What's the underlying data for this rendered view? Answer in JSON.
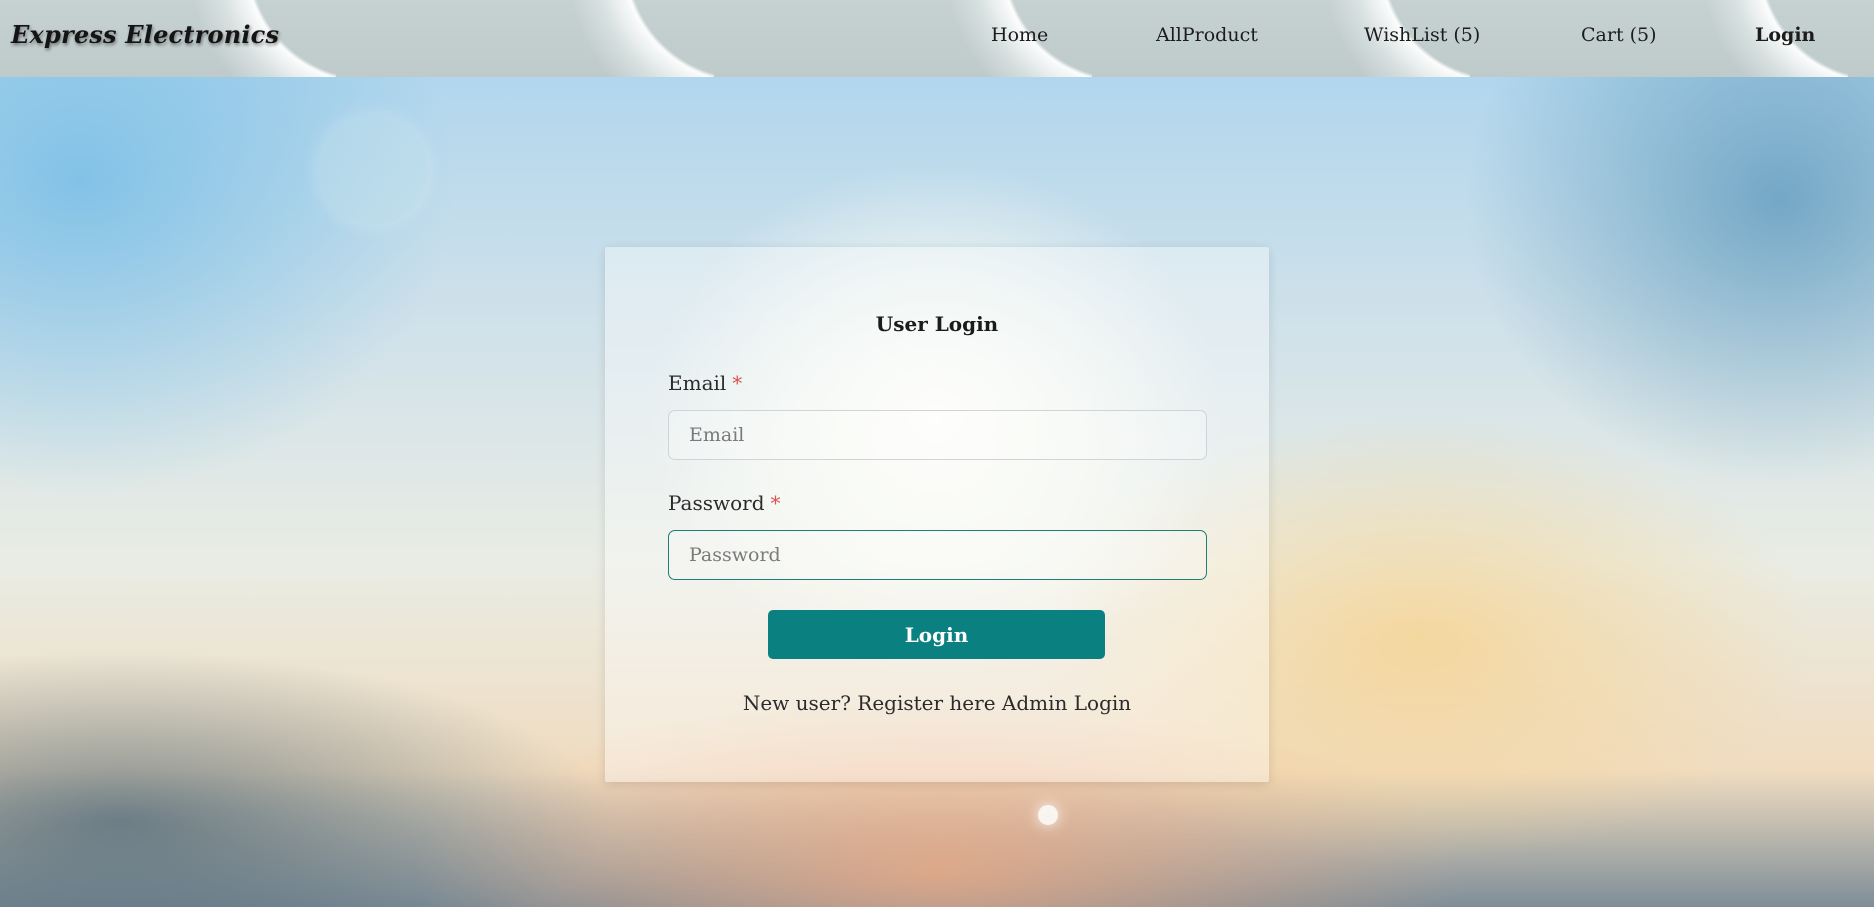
{
  "header": {
    "brand": "Express Electronics",
    "nav": {
      "home": "Home",
      "all_product": "AllProduct",
      "wishlist": "WishList (5)",
      "cart": "Cart (5)",
      "login": "Login"
    }
  },
  "login_form": {
    "title": "User Login",
    "email": {
      "label": "Email",
      "required_marker": "*",
      "placeholder": "Email",
      "value": ""
    },
    "password": {
      "label": "Password",
      "required_marker": "*",
      "placeholder": "Password",
      "value": ""
    },
    "submit_label": "Login",
    "new_user_prefix": "New user?",
    "register_link": "Register here",
    "admin_link": "Admin Login"
  },
  "colors": {
    "accent": "#0a8180",
    "required": "#d9534f",
    "nav_background": "#c3cfcf"
  }
}
